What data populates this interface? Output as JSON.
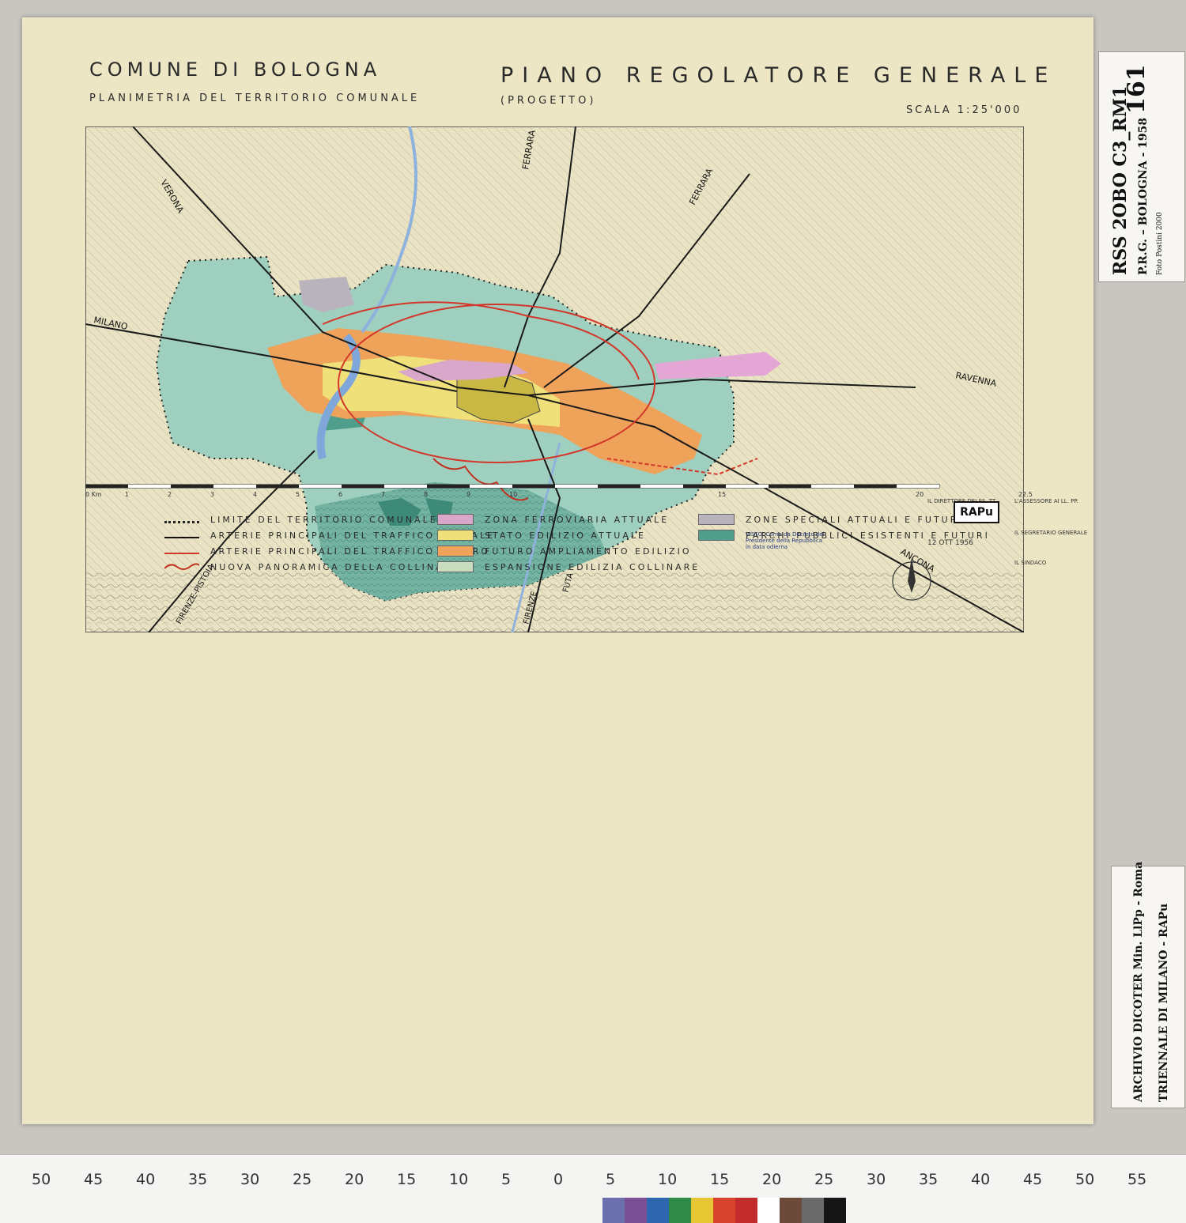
{
  "title": {
    "comune": "COMUNE DI BOLOGNA",
    "piano": "PIANO REGOLATORE GENERALE",
    "planimetria": "PLANIMETRIA DEL TERRITORIO COMUNALE",
    "progetto": "(PROGETTO)",
    "scala": "SCALA 1:25'000"
  },
  "map_labels": {
    "verona": "VERONA",
    "milano": "MILANO",
    "ferrara_a": "FERRARA",
    "ferrara_b": "FERRARA",
    "ravenna": "RAVENNA",
    "ancona": "ANCONA",
    "firenze_a": "FIRENZE",
    "firenze_b": "FIRENZE-PISTOIA",
    "futa": "FUTA"
  },
  "scale_bar": {
    "labels": [
      "0 Km",
      "1",
      "2",
      "3",
      "4",
      "5",
      "6",
      "7",
      "8",
      "9",
      "10",
      "15",
      "20",
      "22.5"
    ]
  },
  "legend": {
    "col1": [
      {
        "symbol": "dotted",
        "label": "LIMITE DEL TERRITORIO COMUNALE"
      },
      {
        "symbol": "black-line",
        "label": "ARTERIE PRINCIPALI DEL TRAFFICO ATTUALE"
      },
      {
        "symbol": "red-black-line",
        "label": "ARTERIE PRINCIPALI DEL TRAFFICO FUTURO"
      },
      {
        "symbol": "wave-line",
        "label": "NUOVA PANORAMICA DELLA COLLINA"
      }
    ],
    "col2": [
      {
        "color": "#d9a7c9",
        "label": "ZONA FERROVIARIA ATTUALE"
      },
      {
        "color": "#efe07a",
        "label": "STATO EDILIZIO ATTUALE"
      },
      {
        "color": "#efa25a",
        "label": "FUTURO AMPLIAMENTO EDILIZIO"
      },
      {
        "color": "#c9dcc0",
        "label": "ESPANSIONE EDILIZIA COLLINARE"
      }
    ],
    "col3": [
      {
        "color": "#b9b3bd",
        "label": "ZONE SPECIALI ATTUALI E FUTURE"
      },
      {
        "color": "#4f9e8b",
        "label": "PARCHI PUBBLICI ESISTENTI E FUTURI"
      }
    ]
  },
  "stamps": {
    "direttore": "IL DIRETTORE DEI SS. TT.",
    "assessore": "L'ASSESSORE AI LL. PP.",
    "segretario": "IL SEGRETARIO GENERALE",
    "sindaco": "IL SINDACO",
    "visto": "VISTO: Come da Decreto del Presidente della Repubblica in data odierna",
    "date": "12 OTT 1956"
  },
  "side_label_top": {
    "code": "RSS 2OBO C3_RM1",
    "number": "161",
    "desc": "P.R.G. – BOLOGNA - 1958",
    "credit": "Foto Postini 2000"
  },
  "side_label_bottom": {
    "line1": "ARCHIVIO DICOTER Min. LlPp - Roma",
    "line2": "TRIENNALE DI MILANO - RAPu"
  },
  "stamp_logo": "RAPu",
  "ruler": {
    "numbers": [
      "50",
      "45",
      "40",
      "35",
      "30",
      "25",
      "20",
      "15",
      "10",
      "5",
      "0",
      "5",
      "10",
      "15",
      "20",
      "25",
      "30",
      "35",
      "40",
      "45",
      "50",
      "55"
    ]
  },
  "colors": {
    "sheet": "#ece6c4",
    "red_line": "#d2372a",
    "park": "#4f9e8b",
    "green_zone": "#9fcfbe",
    "hill": "#74b3a2"
  }
}
